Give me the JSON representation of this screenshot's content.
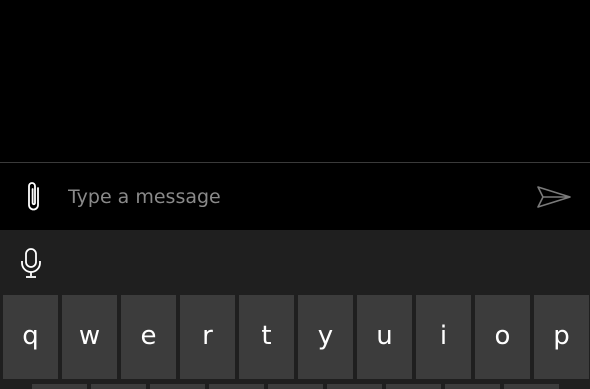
{
  "compose": {
    "placeholder": "Type a message",
    "value": "",
    "attach_icon": "paperclip-icon",
    "send_icon": "send-icon"
  },
  "keyboard": {
    "toolbar": {
      "mic_icon": "microphone-icon"
    },
    "rows": [
      [
        "q",
        "w",
        "e",
        "r",
        "t",
        "y",
        "u",
        "i",
        "o",
        "p"
      ]
    ]
  },
  "colors": {
    "background": "#000000",
    "keyboard_bg": "#1f1f1f",
    "key_bg": "#3c3c3c",
    "key_text": "#ffffff",
    "placeholder": "#8a8a8a",
    "divider": "#3a3a3a"
  }
}
